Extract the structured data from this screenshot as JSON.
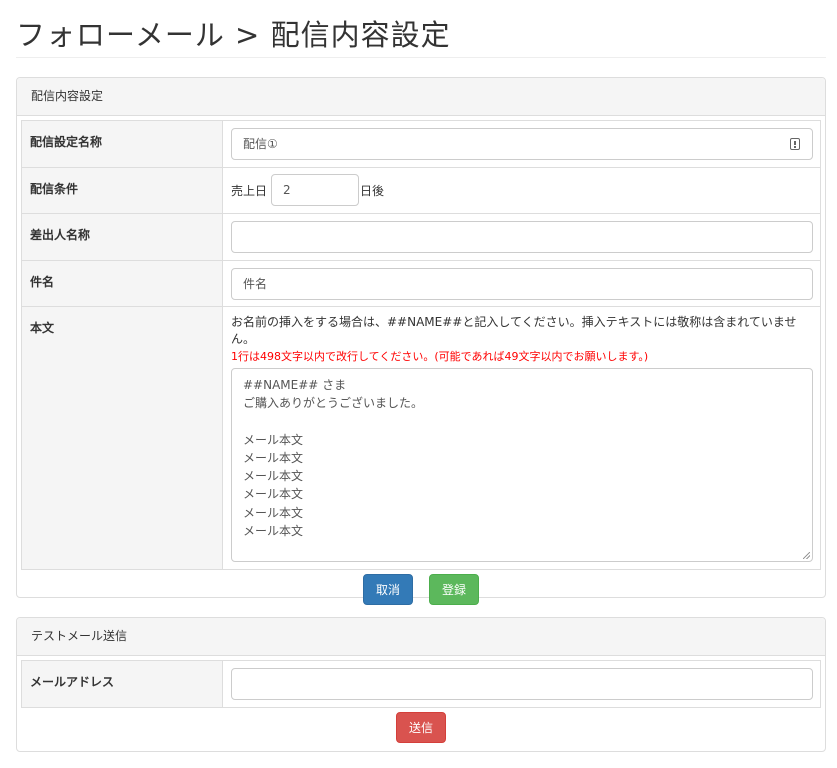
{
  "page": {
    "title": "フォローメール > 配信内容設定"
  },
  "delivery_panel": {
    "heading": "配信内容設定",
    "rows": {
      "setting_name": {
        "label": "配信設定名称",
        "value": "配信①"
      },
      "condition": {
        "label": "配信条件",
        "prefix": "売上日",
        "value": "2",
        "suffix": "日後"
      },
      "sender_name": {
        "label": "差出人名称",
        "value": ""
      },
      "subject": {
        "label": "件名",
        "value": "件名"
      },
      "body": {
        "label": "本文",
        "note": "お名前の挿入をする場合は、##NAME##と記入してください。挿入テキストには敬称は含まれていません。",
        "warning": "1行は498文字以内で改行してください。(可能であれば49文字以内でお願いします。)",
        "lines": [
          "##NAME## さま",
          "ご購入ありがとうございました。",
          "",
          "メール本文",
          "メール本文",
          "メール本文",
          "メール本文",
          "メール本文",
          "メール本文"
        ]
      }
    },
    "cancel_label": "取消",
    "submit_label": "登録"
  },
  "test_panel": {
    "heading": "テストメール送信",
    "email_label": "メールアドレス",
    "email_value": "",
    "send_label": "送信"
  },
  "colors": {
    "primary": "#337ab7",
    "success": "#5cb85c",
    "danger": "#d9534f",
    "warning_text": "#ff0000"
  }
}
